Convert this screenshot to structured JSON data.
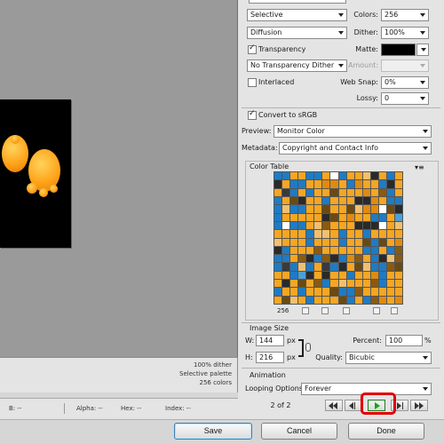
{
  "settings": {
    "palette": "Selective",
    "colors_label": "Colors:",
    "colors_value": "256",
    "dither_algorithm": "Diffusion",
    "dither_label": "Dither:",
    "dither_value": "100%",
    "transparency_label": "Transparency",
    "transparency_checked": true,
    "matte_label": "Matte:",
    "matte_color": "#000000",
    "transparency_dither": "No Transparency Dither",
    "amount_label": "Amount:",
    "interlaced_label": "Interlaced",
    "interlaced_checked": false,
    "websnap_label": "Web Snap:",
    "websnap_value": "0%",
    "lossy_label": "Lossy:",
    "lossy_value": "0",
    "convert_srgb_label": "Convert to sRGB",
    "convert_srgb_checked": true,
    "preview_label": "Preview:",
    "preview_value": "Monitor Color",
    "metadata_label": "Metadata:",
    "metadata_value": "Copyright and Contact Info"
  },
  "color_table": {
    "title": "Color Table",
    "count": "256",
    "palette": [
      "#f5a623",
      "#1e7bc4",
      "#2a2a2a",
      "#6b4a12",
      "#f0c070",
      "#ffffff",
      "#8a5a10",
      "#e08a10",
      "#3a3a3a",
      "#4aa0d8"
    ]
  },
  "image_size": {
    "title": "Image Size",
    "w_label": "W:",
    "w_value": "144",
    "h_label": "H:",
    "h_value": "216",
    "unit": "px",
    "percent_label": "Percent:",
    "percent_value": "100",
    "percent_unit": "%",
    "quality_label": "Quality:",
    "quality_value": "Bicubic"
  },
  "animation": {
    "title": "Animation",
    "looping_label": "Looping Options:",
    "looping_value": "Forever",
    "frame_counter": "2 of 2"
  },
  "preview_info": {
    "dither": "100% dither",
    "palette": "Selective palette",
    "colors": "256 colors"
  },
  "status": {
    "b": "B: --",
    "alpha": "Alpha: --",
    "hex": "Hex: --",
    "index": "Index: --"
  },
  "buttons": {
    "save": "Save",
    "cancel": "Cancel",
    "done": "Done"
  },
  "colors": {
    "highlight": "#e00000",
    "accent_blue": "#3c7fb1",
    "play_green": "#1aa11a"
  }
}
